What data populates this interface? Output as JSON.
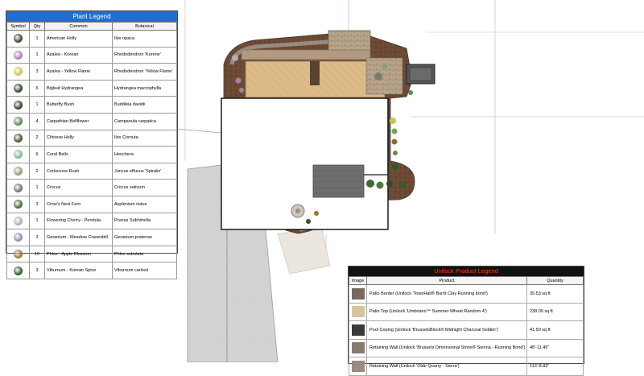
{
  "plant_legend": {
    "title": "Plant Legend",
    "columns": [
      "Symbol",
      "Qty",
      "Common",
      "Botanical"
    ],
    "rows": [
      {
        "qty": "1",
        "common": "American Holly",
        "botanical": "Ilex opaca",
        "color": "#3d4a2e",
        "icon": "holly-symbol-icon"
      },
      {
        "qty": "1",
        "common": "Azalea - Korean",
        "botanical": "Rhododendron 'Korene'",
        "color": "#b07fb0",
        "icon": "azalea-symbol-icon"
      },
      {
        "qty": "3",
        "common": "Azalea - Yellow Flame",
        "botanical": "Rhododendron 'Yellow Flame'",
        "color": "#c9c84a",
        "icon": "azalea-yellow-symbol-icon"
      },
      {
        "qty": "6",
        "common": "Bigleaf Hydrangea",
        "botanical": "Hydrangea macrophylla",
        "color": "#2f4a2a",
        "icon": "hydrangea-symbol-icon"
      },
      {
        "qty": "1",
        "common": "Butterfly Bush",
        "botanical": "Buddleia davidii",
        "color": "#3a4030",
        "icon": "butterfly-bush-symbol-icon"
      },
      {
        "qty": "4",
        "common": "Carpathian Bellflower",
        "botanical": "Campanula carpatica",
        "color": "#5a8a5a",
        "icon": "bellflower-symbol-icon"
      },
      {
        "qty": "2",
        "common": "Chinese Holly",
        "botanical": "Ilex Cornuta",
        "color": "#3f5a35",
        "icon": "chinese-holly-symbol-icon"
      },
      {
        "qty": "6",
        "common": "Coral Bells",
        "botanical": "Heuchera",
        "color": "#7fbf8f",
        "icon": "coral-bells-symbol-icon"
      },
      {
        "qty": "2",
        "common": "Corkscrew Rush",
        "botanical": "Juncus effusus 'Spiralis'",
        "color": "#8aa07a",
        "icon": "corkscrew-rush-symbol-icon"
      },
      {
        "qty": "1",
        "common": "Crocus",
        "botanical": "Crocus sativum",
        "color": "#6a7a6a",
        "icon": "crocus-symbol-icon"
      },
      {
        "qty": "3",
        "common": "Crow's Nest Fern",
        "botanical": "Asplenium nidus",
        "color": "#4d6a3f",
        "icon": "fern-symbol-icon"
      },
      {
        "qty": "1",
        "common": "Flowering Cherry - Pendula",
        "botanical": "Prunus Subhirtella",
        "color": "#b9a9b9",
        "icon": "cherry-symbol-icon"
      },
      {
        "qty": "3",
        "common": "Geranium - Meadow Cranesbill",
        "botanical": "Geranium pratense",
        "color": "#9a88aa",
        "icon": "geranium-symbol-icon"
      },
      {
        "qty": "10",
        "common": "Phlox - Apple Blossom",
        "botanical": "Phlox subulata",
        "color": "#a0782e",
        "icon": "phlox-symbol-icon"
      },
      {
        "qty": "3",
        "common": "Viburnum - Korean Spice",
        "botanical": "Viburnum carlesii",
        "color": "#2e5a2a",
        "icon": "viburnum-symbol-icon"
      }
    ]
  },
  "product_legend": {
    "title": "Unilock Product Legend",
    "columns": [
      "Image",
      "Product",
      "Quantity"
    ],
    "rows": [
      {
        "product": "Patio Border (Unilock 'TownHall® Burnt Clay Running bond')",
        "quantity": "35.53 sq ft",
        "color": "#7a6a5e"
      },
      {
        "product": "Patio Top (Unilock 'Umbriano™ Summer Wheat Random 4')",
        "quantity": "238.09 sq ft",
        "color": "#d8c49e"
      },
      {
        "product": "Pool Coping (Unilock 'BrusselsBlock® Midnight Charcoal Soldier')",
        "quantity": "41.59 sq ft",
        "color": "#3a3a3a"
      },
      {
        "product": "Retaining Wall (Unilock 'Brussels Dimensional Stone® Sienna - Running Bond')",
        "quantity": "48'-11.45\"",
        "color": "#8a7a6e"
      },
      {
        "product": "Retaining Wall (Unilock 'Olde Quarry - Sierra')",
        "quantity": "113'-8.83\"",
        "color": "#9a8a80"
      }
    ]
  },
  "colors": {
    "plant_legend_header": "#1e6fd0",
    "product_legend_header": "#111111",
    "product_legend_title_text": "#ff3b1f",
    "patio_top": "#d8b88a",
    "mulch": "#6b4a35",
    "driveway": "#d0d0d0",
    "roof": "#6e6e6e"
  }
}
